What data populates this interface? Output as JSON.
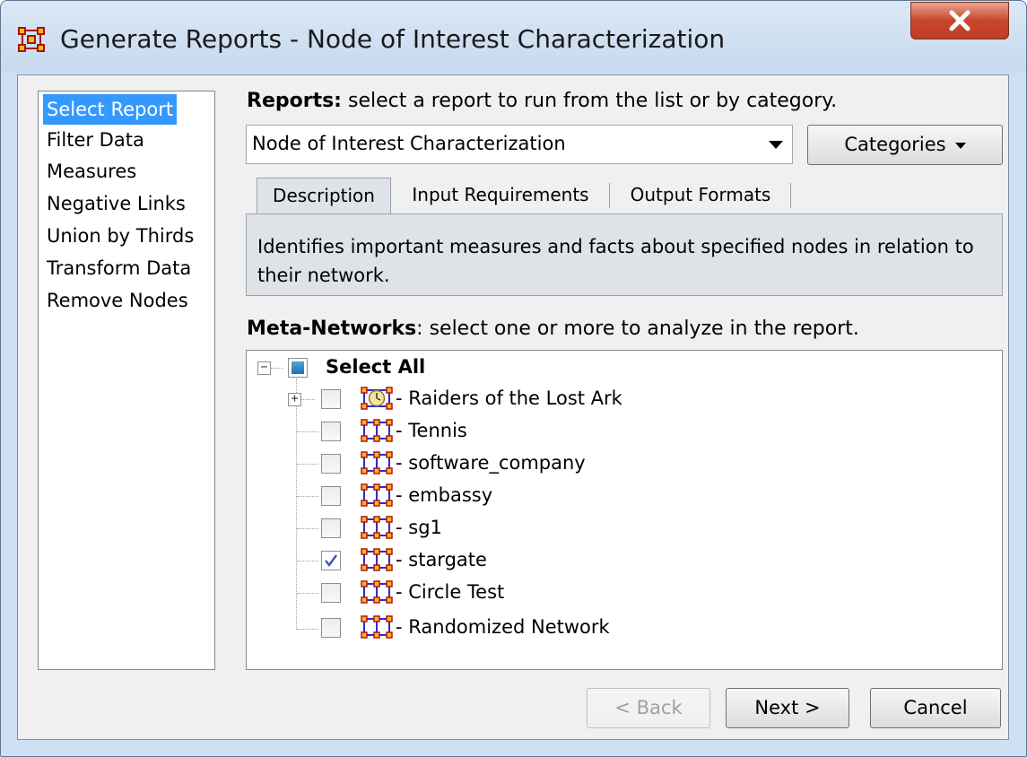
{
  "window": {
    "title": "Generate Reports - Node of Interest Characterization"
  },
  "sidebar": {
    "items": [
      {
        "label": "Select Report",
        "selected": true
      },
      {
        "label": "Filter Data"
      },
      {
        "label": "Measures"
      },
      {
        "label": "Negative Links"
      },
      {
        "label": "Union by Thirds"
      },
      {
        "label": "Transform Data"
      },
      {
        "label": "Remove Nodes"
      }
    ]
  },
  "reports": {
    "heading_bold": "Reports:",
    "heading_rest": " select a report to run from the list or by category.",
    "selected": "Node of Interest Characterization",
    "categories_label": "Categories"
  },
  "tabs": [
    {
      "label": "Description",
      "active": true
    },
    {
      "label": "Input Requirements"
    },
    {
      "label": "Output Formats"
    }
  ],
  "description": "Identifies important measures and facts about specified nodes in relation to their network.",
  "meta_networks": {
    "heading_bold": "Meta-Networks",
    "heading_rest": ": select one or more to analyze in the report.",
    "select_all": "Select All",
    "items": [
      {
        "label": "Raiders of the Lost Ark",
        "checked": false,
        "expandable": true
      },
      {
        "label": "Tennis",
        "checked": false
      },
      {
        "label": "software_company",
        "checked": false
      },
      {
        "label": "embassy",
        "checked": false
      },
      {
        "label": "sg1",
        "checked": false
      },
      {
        "label": "stargate",
        "checked": true
      },
      {
        "label": "Circle Test",
        "checked": false
      },
      {
        "label": "Randomized Network",
        "checked": false
      }
    ]
  },
  "buttons": {
    "back": "< Back",
    "next": "Next >",
    "cancel": "Cancel"
  },
  "colors": {
    "selection": "#3399ff",
    "close": "#c9462c",
    "frame": "#cfe0f2"
  },
  "icons": [
    "app-icon",
    "close-icon",
    "network-icon",
    "clock-network-icon",
    "check-icon"
  ]
}
